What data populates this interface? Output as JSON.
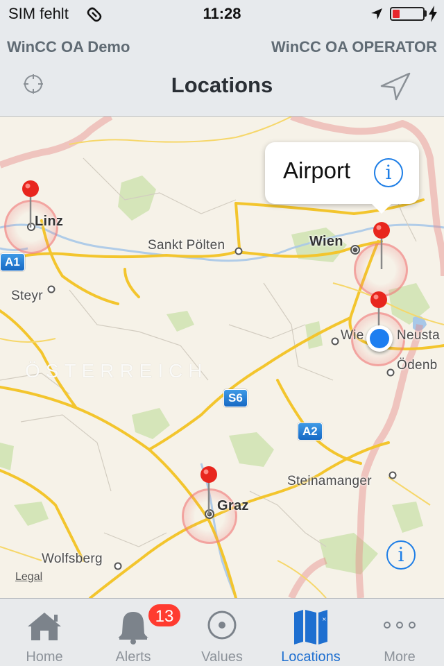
{
  "status_bar": {
    "carrier": "SIM fehlt",
    "time": "11:28",
    "battery_level_percent": 15,
    "icons": [
      "wifi-icon",
      "location-arrow-icon",
      "battery-icon",
      "charging-bolt-icon"
    ]
  },
  "subheader": {
    "left": "WinCC OA Demo",
    "right": "WinCC OA OPERATOR"
  },
  "navbar": {
    "title": "Locations",
    "left_icon": "crosshair-icon",
    "right_icon": "location-arrow-icon"
  },
  "map": {
    "callout": {
      "title": "Airport",
      "icon": "info-icon"
    },
    "country_label": "ÖSTERREICH",
    "cities": [
      {
        "name": "Linz"
      },
      {
        "name": "Steyr"
      },
      {
        "name": "Sankt Pölten"
      },
      {
        "name": "Wien"
      },
      {
        "name": "Wiener Neustadt"
      },
      {
        "name": "Ödenburg"
      },
      {
        "name": "Steinamanger"
      },
      {
        "name": "Graz"
      },
      {
        "name": "Wolfsberg"
      }
    ],
    "city_display": {
      "linz": "Linz",
      "steyr": "Steyr",
      "st_poelten": "Sankt Pölten",
      "wien": "Wien",
      "wiener_neustadt": "Wie",
      "wiener_neustadt_tail": "Neusta",
      "oedenburg": "Ödenb",
      "steinamanger": "Steinamanger",
      "graz": "Graz",
      "wolfsberg": "Wolfsberg"
    },
    "road_shields": [
      "A1",
      "S6",
      "A2"
    ],
    "pins": [
      {
        "name": "Linz",
        "color": "#e8261e"
      },
      {
        "name": "Airport",
        "color": "#e8261e"
      },
      {
        "name": "Wiener Neustadt",
        "color": "#e8261e"
      },
      {
        "name": "Graz",
        "color": "#e8261e"
      }
    ],
    "legal_link": "Legal"
  },
  "tabbar": {
    "tabs": [
      {
        "label": "Home",
        "icon": "home-icon",
        "active": false
      },
      {
        "label": "Alerts",
        "icon": "bell-icon",
        "active": false,
        "badge": "13"
      },
      {
        "label": "Values",
        "icon": "target-icon",
        "active": false
      },
      {
        "label": "Locations",
        "icon": "map-icon",
        "active": true
      },
      {
        "label": "More",
        "icon": "more-dots-icon",
        "active": false
      }
    ]
  },
  "colors": {
    "accent": "#1e6fd0",
    "badge": "#ff3b30",
    "pin": "#e8261e",
    "user_location": "#1d7ef0"
  }
}
